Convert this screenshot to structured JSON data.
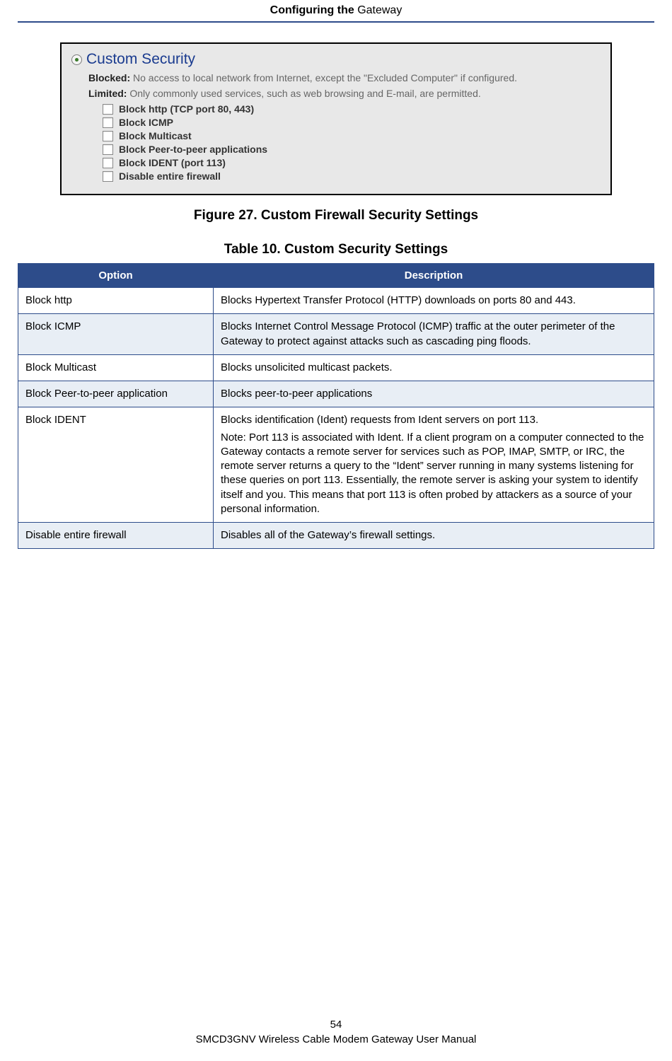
{
  "header": {
    "bold": "Configuring the ",
    "light": "Gateway"
  },
  "screenshot": {
    "radio_title": "Custom Security",
    "blocked_label": "Blocked:",
    "blocked_text": " No access to local network from Internet, except the \"Excluded Computer\" if configured.",
    "limited_label": "Limited:",
    "limited_text": " Only commonly used services, such as web browsing and E-mail, are permitted.",
    "checkboxes": [
      "Block http (TCP port 80, 443)",
      "Block ICMP",
      "Block Multicast",
      "Block Peer-to-peer applications",
      "Block IDENT (port 113)",
      "Disable entire firewall"
    ]
  },
  "figure_caption": "Figure 27. Custom Firewall Security Settings",
  "table_caption": "Table 10. Custom Security Settings",
  "table": {
    "head": {
      "option": "Option",
      "description": "Description"
    },
    "rows": [
      {
        "option": "Block http",
        "desc": [
          "Blocks Hypertext Transfer Protocol (HTTP) downloads on ports 80 and 443."
        ],
        "alt": false
      },
      {
        "option": "Block ICMP",
        "desc": [
          "Blocks Internet Control Message Protocol (ICMP) traffic at the outer perimeter of the Gateway to protect against attacks such as cascading ping floods."
        ],
        "alt": true
      },
      {
        "option": "Block Multicast",
        "desc": [
          "Blocks unsolicited multicast packets."
        ],
        "alt": false
      },
      {
        "option": "Block Peer-to-peer application",
        "desc": [
          "Blocks peer-to-peer applications"
        ],
        "alt": true
      },
      {
        "option": "Block IDENT",
        "desc": [
          "Blocks identification (Ident) requests from Ident servers on port 113.",
          "Note: Port 113 is associated with Ident. If a client program on a computer connected to the Gateway contacts a remote server for services such as POP, IMAP, SMTP, or IRC, the remote server returns a query to the “Ident” server running in many systems listening for these queries on port 113. Essentially, the remote server is asking your system to identify itself and you. This means that port 113 is often probed by attackers as a source of your personal information."
        ],
        "alt": false
      },
      {
        "option": "Disable entire firewall",
        "desc": [
          "Disables all of the Gateway’s firewall settings."
        ],
        "alt": true
      }
    ]
  },
  "footer": {
    "page": "54",
    "manual": "SMCD3GNV Wireless Cable Modem Gateway User Manual"
  }
}
